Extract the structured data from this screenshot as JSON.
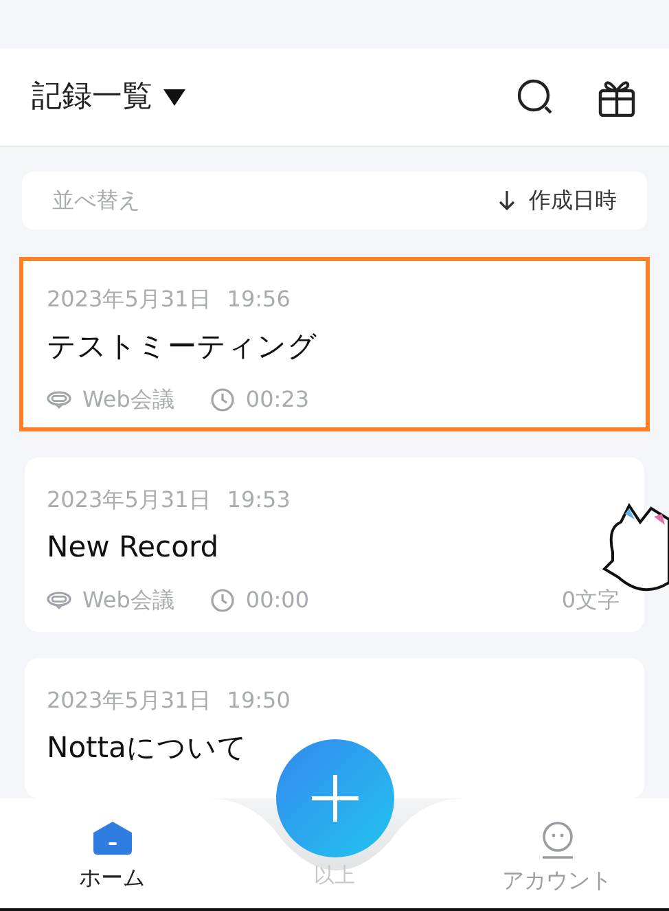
{
  "header": {
    "title": "記録一覧"
  },
  "sort": {
    "label": "並べ替え",
    "value": "作成日時"
  },
  "records": [
    {
      "date": "2023年5月31日",
      "time": "19:56",
      "title": "テストミーティング",
      "source": "Web会議",
      "duration": "00:23",
      "selected": true
    },
    {
      "date": "2023年5月31日",
      "time": "19:53",
      "title": "New Record",
      "source": "Web会議",
      "duration": "00:00",
      "chars": "0文字",
      "selected": false
    },
    {
      "date": "2023年5月31日",
      "time": "19:50",
      "title": "Nottaについて",
      "selected": false
    }
  ],
  "nav": [
    {
      "kind": "home",
      "label": "ホーム",
      "selected": true
    },
    {
      "kind": "add",
      "label": "以上",
      "selected": false
    },
    {
      "kind": "account",
      "label": "アカウント",
      "selected": false
    }
  ]
}
